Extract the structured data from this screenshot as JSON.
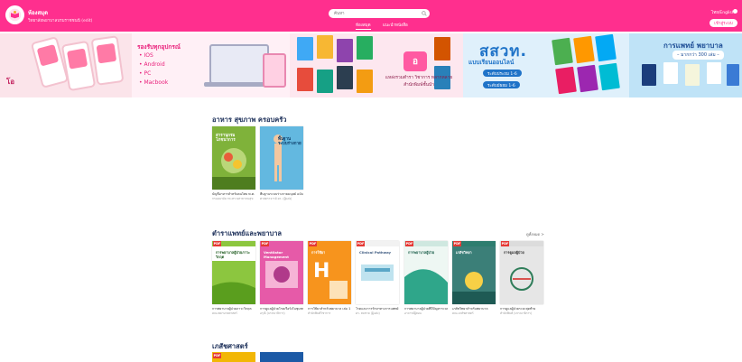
{
  "header": {
    "brand_name": "ห้องสมุด",
    "brand_sub": "วิทยาลัยพยาบาลบรมราชชนนี (edit)",
    "search_placeholder": "ค้นหา",
    "nav": [
      {
        "label": "ห้องสมุด",
        "active": true
      },
      {
        "label": "แนะนำหนังสือ",
        "active": false
      }
    ],
    "lang_label": "ไทย/English",
    "login_label": "เข้าสู่ระบบ"
  },
  "banner": {
    "slide1_text": "โอ",
    "slide2_title": "รองรับทุกอุปกรณ์",
    "slide2_items": [
      "• IOS",
      "• Android",
      "• PC",
      "• Macbook"
    ],
    "slide3_badge": "อ",
    "slide3_text": "แหล่งรวมตำรา วิชาการ หลากหลายสำนักพิมพ์ชั้นนำ",
    "slide4_title": "สสวท.",
    "slide4_sub": "แบบเรียนออนไลน์",
    "slide4_pills": [
      "ระดับประถม 1-6",
      "ระดับมัธยม 1-6"
    ],
    "slide5_title": "การแพทย์ พยาบาล",
    "slide5_pill": "– มากกว่า 300 เล่ม –"
  },
  "sections": [
    {
      "title": "อาหาร สุขภาพ ครอบครัว",
      "books": [
        {
          "title": "บัญชีอาหารสำหรับคนไทย พ.ศ. 2564",
          "author": "กรมอนามัย กระทรวงสาธารณสุข",
          "cover_color": "#7fb23a",
          "cover_text": "สารานุกรมโภชนาการ",
          "pdf": false
        },
        {
          "title": "พื้นฐานระบบร่างกายมนุษย์ ฉบับปรับปรุงใหม่",
          "author": "ศาสตราจารย์ ดร. (ผู้แต่ง)",
          "cover_color": "#5bb0d8",
          "cover_text": "พื้นฐาน ระบบร่างกาย",
          "pdf": false
        }
      ]
    },
    {
      "title": "ตำราแพทย์และพยาบาล",
      "see_all": "ดูทั้งหมด >",
      "books": [
        {
          "title": "การพยาบาลผู้ป่วยภาวะวิกฤต",
          "author": "คณะพยาบาลศาสตร์",
          "cover_color": "#8cc63f",
          "cover_text": "การพยาบาลผู้ป่วยภาวะวิกฤต",
          "pdf": true
        },
        {
          "title": "การดูแลผู้ป่วยโรคเรื้อรังในชุมชน",
          "author": "อรุณี (บรรณาธิการ)",
          "cover_color": "#e65aa8",
          "cover_text": "Ventilator Management",
          "pdf": true
        },
        {
          "title": "การใช้ยาสำหรับพยาบาล เล่ม 1",
          "author": "สำนักพิมพ์วิชาการ",
          "cover_color": "#f7941d",
          "cover_text": "การใช้ยา",
          "pdf": true
        },
        {
          "title": "โรคและการรักษาทางการแพทย์ (SPT) 2",
          "author": "ดร. สมชาย (ผู้แต่ง)",
          "cover_color": "#f2f2f2",
          "cover_text": "Clinical Pathway",
          "pdf": true
        },
        {
          "title": "การพยาบาลผู้ป่วยที่มีปัญหาระบบทางเดินหายใจ",
          "author": "อาจารย์ผู้สอน",
          "cover_color": "#cfe8e0",
          "cover_text": "การพยาบาลผู้ป่วย",
          "pdf": true
        },
        {
          "title": "เภสัชวิทยาสำหรับพยาบาล",
          "author": "คณะเภสัชศาสตร์",
          "cover_color": "#2e7d6f",
          "cover_text": "เภสัชวิทยา",
          "pdf": true
        },
        {
          "title": "การดูแลผู้ป่วยระยะสุดท้าย",
          "author": "สำนักพิมพ์ (บรรณาธิการ)",
          "cover_color": "#dcdcdc",
          "cover_text": "การดูแลผู้ป่วย",
          "pdf": true
        }
      ]
    },
    {
      "title": "เภสัชศาสตร์",
      "books": [
        {
          "title": "",
          "author": "",
          "cover_color": "#f2b705",
          "cover_text": "",
          "pdf": true
        },
        {
          "title": "",
          "author": "",
          "cover_color": "#1c5aa6",
          "cover_text": "",
          "pdf": false
        }
      ]
    }
  ]
}
